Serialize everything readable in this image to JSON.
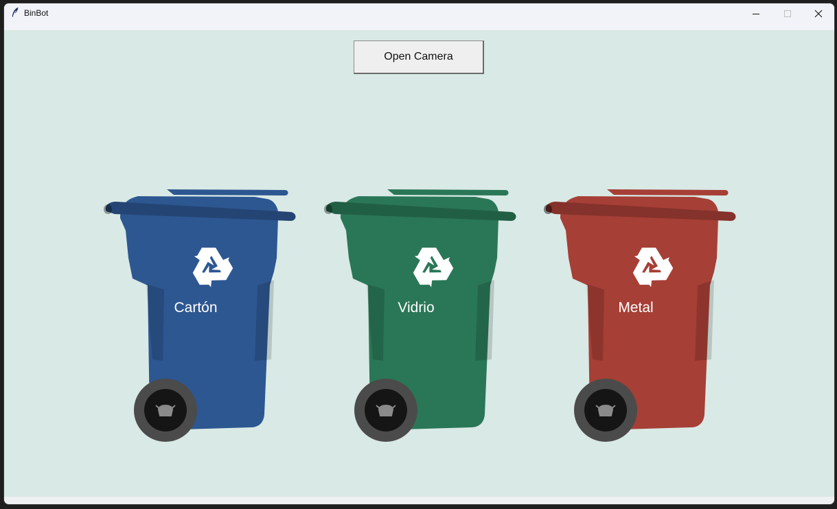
{
  "window": {
    "title": "BinBot",
    "app_icon": "feather-icon",
    "controls": [
      "minimize-icon",
      "maximize-icon",
      "close-icon"
    ]
  },
  "toolbar": {
    "open_camera_label": "Open Camera"
  },
  "bins": [
    {
      "label": "Cartón",
      "color": "#2d5791",
      "icon": "recycle-icon"
    },
    {
      "label": "Vidrio",
      "color": "#2a7757",
      "icon": "recycle-icon"
    },
    {
      "label": "Metal",
      "color": "#a63f36",
      "icon": "recycle-icon"
    }
  ],
  "colors": {
    "background": "#d9e9e5",
    "wheel_outer": "#4b4b4b",
    "wheel_inner": "#151515"
  }
}
